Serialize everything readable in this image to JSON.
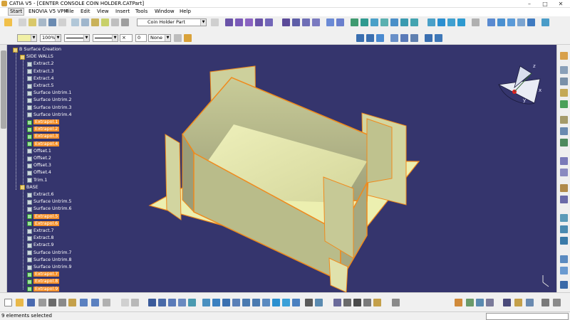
{
  "window": {
    "title": "CATIA V5 - [CENTER CONSOLE COIN HOLDER.CATPart]",
    "minimize_glyph": "–",
    "maximize_glyph": "□",
    "close_glyph": "✕"
  },
  "menu": [
    {
      "label": "Start",
      "id": "start"
    },
    {
      "label": "ENOVIA V5 VPM",
      "id": "enovia"
    },
    {
      "label": "File",
      "id": "file"
    },
    {
      "label": "Edit",
      "id": "edit"
    },
    {
      "label": "View",
      "id": "view"
    },
    {
      "label": "Insert",
      "id": "insert"
    },
    {
      "label": "Tools",
      "id": "tools"
    },
    {
      "label": "Window",
      "id": "window"
    },
    {
      "label": "Help",
      "id": "help"
    }
  ],
  "graphic_props": {
    "zoom": "100%",
    "layer_value": "0",
    "layer_filter": "None"
  },
  "tools_palette": {
    "active_part": "Coin Holder Part"
  },
  "tree": [
    {
      "label": "B Surface Creation",
      "kind": "group",
      "depth": 0
    },
    {
      "label": "SIDE WALLS",
      "kind": "group",
      "depth": 1
    },
    {
      "label": "Extract.2",
      "kind": "normal",
      "depth": 2
    },
    {
      "label": "Extract.3",
      "kind": "normal",
      "depth": 2
    },
    {
      "label": "Extract.4",
      "kind": "normal",
      "depth": 2
    },
    {
      "label": "Extract.5",
      "kind": "normal",
      "depth": 2
    },
    {
      "label": "Surface Untrim.1",
      "kind": "normal",
      "depth": 2
    },
    {
      "label": "Surface Untrim.2",
      "kind": "normal",
      "depth": 2
    },
    {
      "label": "Surface Untrim.3",
      "kind": "normal",
      "depth": 2
    },
    {
      "label": "Surface Untrim.4",
      "kind": "normal",
      "depth": 2
    },
    {
      "label": "Extrapol.1",
      "kind": "hidden",
      "depth": 2
    },
    {
      "label": "Extrapol.2",
      "kind": "hidden",
      "depth": 2
    },
    {
      "label": "Extrapol.3",
      "kind": "hidden",
      "depth": 2
    },
    {
      "label": "Extrapol.4",
      "kind": "hidden",
      "depth": 2
    },
    {
      "label": "Offset.1",
      "kind": "normal",
      "depth": 2
    },
    {
      "label": "Offset.2",
      "kind": "normal",
      "depth": 2
    },
    {
      "label": "Offset.3",
      "kind": "normal",
      "depth": 2
    },
    {
      "label": "Offset.4",
      "kind": "normal",
      "depth": 2
    },
    {
      "label": "Trim.1",
      "kind": "normal",
      "depth": 2
    },
    {
      "label": "BASE",
      "kind": "group",
      "depth": 1
    },
    {
      "label": "Extract.6",
      "kind": "normal",
      "depth": 2
    },
    {
      "label": "Surface Untrim.5",
      "kind": "normal",
      "depth": 2
    },
    {
      "label": "Surface Untrim.6",
      "kind": "normal",
      "depth": 2
    },
    {
      "label": "Extrapol.5",
      "kind": "hidden",
      "depth": 2
    },
    {
      "label": "Extrapol.6",
      "kind": "hidden",
      "depth": 2
    },
    {
      "label": "Extract.7",
      "kind": "normal",
      "depth": 2
    },
    {
      "label": "Extract.8",
      "kind": "normal",
      "depth": 2
    },
    {
      "label": "Extract.9",
      "kind": "normal",
      "depth": 2
    },
    {
      "label": "Surface Untrim.7",
      "kind": "normal",
      "depth": 2
    },
    {
      "label": "Surface Untrim.8",
      "kind": "normal",
      "depth": 2
    },
    {
      "label": "Surface Untrim.9",
      "kind": "normal",
      "depth": 2
    },
    {
      "label": "Extrapol.7",
      "kind": "hidden",
      "depth": 2
    },
    {
      "label": "Extrapol.8",
      "kind": "hidden",
      "depth": 2
    },
    {
      "label": "Extrapol.9",
      "kind": "hidden",
      "depth": 2
    }
  ],
  "compass": {
    "x_label": "x",
    "y_label": "y",
    "z_label": "z"
  },
  "status": {
    "selection": "9 elements selected"
  },
  "colors": {
    "viewport_bg": "#35356d",
    "surface_fill": "#e8eaa6",
    "wall_fill": "#b8ba8a",
    "edge_highlight": "#f08a1c",
    "hidden_item_bg": "#f4902a"
  }
}
